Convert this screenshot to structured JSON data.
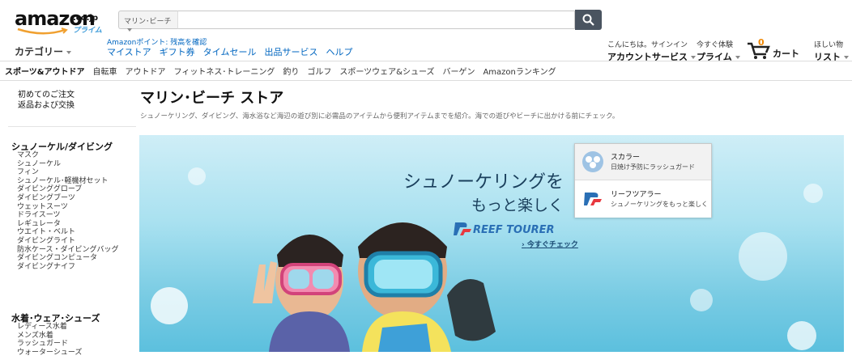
{
  "header": {
    "logo_text": "amazon",
    "logo_suffix": ".co.jp",
    "logo_prime": "プライム",
    "search_scope": "マリン･ビーチ",
    "search_placeholder": "",
    "points_text": "Amazonポイント: 残高を確認",
    "categories_label": "カテゴリー",
    "nav_links": [
      "マイストア",
      "ギフト券",
      "タイムセール",
      "出品サービス",
      "ヘルプ"
    ],
    "account_line1": "こんにちは。サインイン",
    "account_line2": "アカウントサービス",
    "prime_line1": "今すぐ体験",
    "prime_line2": "プライム",
    "cart_count": "0",
    "cart_label": "カート",
    "wishlist_line1": "ほしい物",
    "wishlist_line2": "リスト"
  },
  "subnav": {
    "store": "スポーツ&アウトドア",
    "items": [
      "自転車",
      "アウトドア",
      "フィットネス･トレーニング",
      "釣り",
      "ゴルフ",
      "スポーツウェア&シューズ",
      "バーゲン",
      "Amazonランキング"
    ]
  },
  "sidebar": {
    "top_links": [
      "初めてのご注文",
      "返品および交換"
    ],
    "sections": [
      {
        "title": "シュノーケル/ダイビング",
        "items": [
          "マスク",
          "シュノーケル",
          "フィン",
          "シュノーケル･軽機材セット",
          "ダイビンググローブ",
          "ダイビングブーツ",
          "ウェットスーツ",
          "ドライスーツ",
          "レギュレータ",
          "ウエイト・ベルト",
          "ダイビングライト",
          "防水ケース・ダイビングバッグ",
          "ダイビングコンピュータ",
          "ダイビングナイフ"
        ]
      },
      {
        "title": "水着･ウェア･シューズ",
        "items": [
          "レディース水着",
          "メンズ水着",
          "ラッシュガード",
          "ウォーターシューズ"
        ]
      }
    ]
  },
  "main": {
    "title": "マリン･ビーチ ストア",
    "description": "シュノーケリング、ダイビング、海水浴など海辺の遊び別に必需品のアイテムから便利アイテムまでを紹介。海での遊びやビーチに出かける前にチェック。",
    "banner": {
      "headline_line1": "シュノーケリングを",
      "headline_line2": "もっと楽しく",
      "brand": "REEF TOURER",
      "cta": "今すぐチェック",
      "promos": [
        {
          "title": "スカラー",
          "subtitle": "日焼け予防にラッシュガード"
        },
        {
          "title": "リーフツアラー",
          "subtitle": "シュノーケリングをもっと楽しく"
        }
      ]
    }
  }
}
